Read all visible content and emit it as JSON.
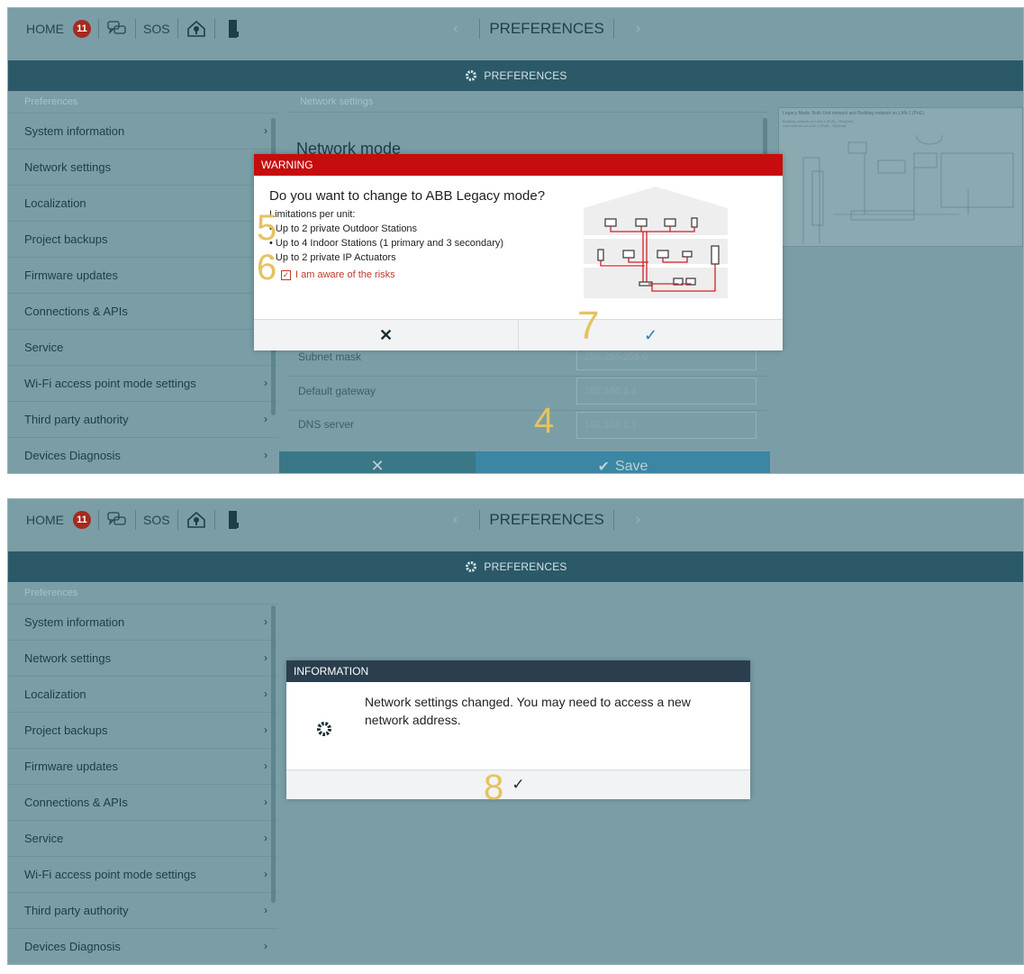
{
  "colors": {
    "background": "#7b9ea6",
    "header_bar": "#2b5968",
    "warning_red": "#c60c0c",
    "info_navy": "#2a3e4e",
    "step_numbers": "#e5c35f",
    "badge_red": "#a62a1e"
  },
  "topbar": {
    "home_label": "HOME",
    "badge_count": "11",
    "sos_label": "SOS",
    "icons": [
      "chat-icon",
      "house-alert-icon",
      "door-icon"
    ],
    "title": "PREFERENCES"
  },
  "header_bar": {
    "label": "PREFERENCES",
    "icon": "gear-icon"
  },
  "sidebar": {
    "header": "Preferences",
    "items": [
      "System information",
      "Network settings",
      "Localization",
      "Project backups",
      "Firmware updates",
      "Connections & APIs",
      "Service",
      "Wi-Fi access point mode settings",
      "Third party authority",
      "Devices Diagnosis"
    ]
  },
  "panel1": {
    "content_header": "Network settings",
    "section_title": "Network mode",
    "fields": [
      {
        "label": "Subnet mask",
        "value": "255.255.255.0"
      },
      {
        "label": "Default gateway",
        "value": "192.168.1.1"
      },
      {
        "label": "DNS server",
        "value": "192.168.1.1"
      }
    ],
    "save_label": "Save",
    "cancel_icon": "close-icon",
    "diagram": {
      "title": "Legacy Mode: Both Unit network and Building network on LAN-1 (PoE)",
      "line1": "Building network on LAN-1 (PoE) - Required",
      "line2": "Unit network on LAN-1 (PoE) - Optional"
    }
  },
  "warning_dialog": {
    "header": "WARNING",
    "question": "Do you want to change to ABB Legacy mode?",
    "limitations_title": "Limitations per unit:",
    "limitations": [
      "• Up to 2 private Outdoor Stations",
      "• Up to 4 Indoor Stations (1 primary and 3 secondary)",
      "• Up to 2 private IP Actuators"
    ],
    "checkbox_label": "I am aware of the risks",
    "checkbox_checked": true,
    "cancel_icon": "close-icon",
    "confirm_icon": "check-icon"
  },
  "panel2": {
    "info_dialog": {
      "header": "INFORMATION",
      "message": "Network settings changed. You may need to access a new network address.",
      "icon": "gear-icon",
      "confirm_icon": "check-icon"
    }
  },
  "step_numbers": {
    "n4": "4",
    "n5": "5",
    "n6": "6",
    "n7": "7",
    "n8": "8"
  }
}
